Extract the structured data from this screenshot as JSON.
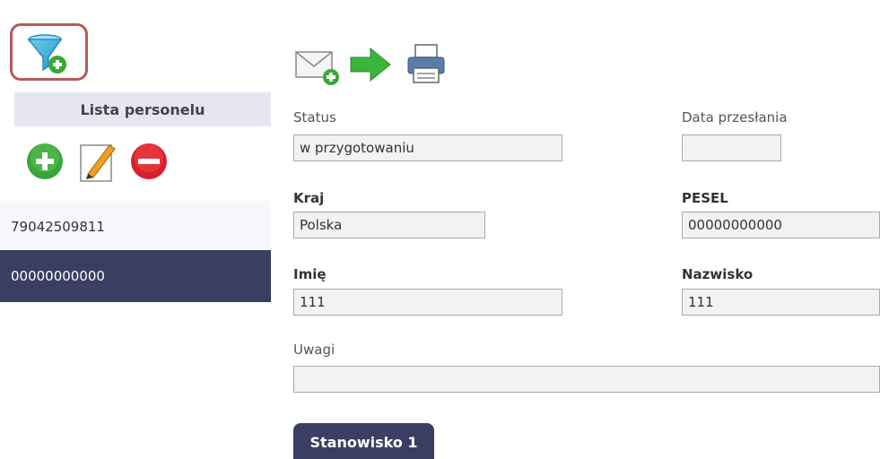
{
  "sidebar": {
    "filter_icon": "filter-add-icon",
    "list_title": "Lista personelu",
    "actions": [
      {
        "icon": "add-icon",
        "color": "#3aa63a"
      },
      {
        "icon": "edit-icon",
        "color": "#f0a020"
      },
      {
        "icon": "delete-icon",
        "color": "#d8202a"
      }
    ],
    "items": [
      {
        "label": "79042509811",
        "selected": false
      },
      {
        "label": "00000000000",
        "selected": true
      }
    ]
  },
  "toolbar": {
    "icons": [
      "mail-add-icon",
      "arrow-right-icon",
      "printer-icon"
    ]
  },
  "form": {
    "status_label": "Status",
    "status_value": "w przygotowaniu",
    "date_label": "Data przesłania",
    "date_value": "",
    "country_label": "Kraj",
    "country_value": "Polska",
    "pesel_label": "PESEL",
    "pesel_value": "00000000000",
    "firstname_label": "Imię",
    "firstname_value": "111",
    "lastname_label": "Nazwisko",
    "lastname_value": "111",
    "notes_label": "Uwagi",
    "notes_value": ""
  },
  "tabs": {
    "position_label": "Stanowisko 1"
  },
  "colors": {
    "selected_bg": "#3b3e63",
    "header_bg": "#e6e6f3",
    "highlight_border": "#b55a5a"
  }
}
